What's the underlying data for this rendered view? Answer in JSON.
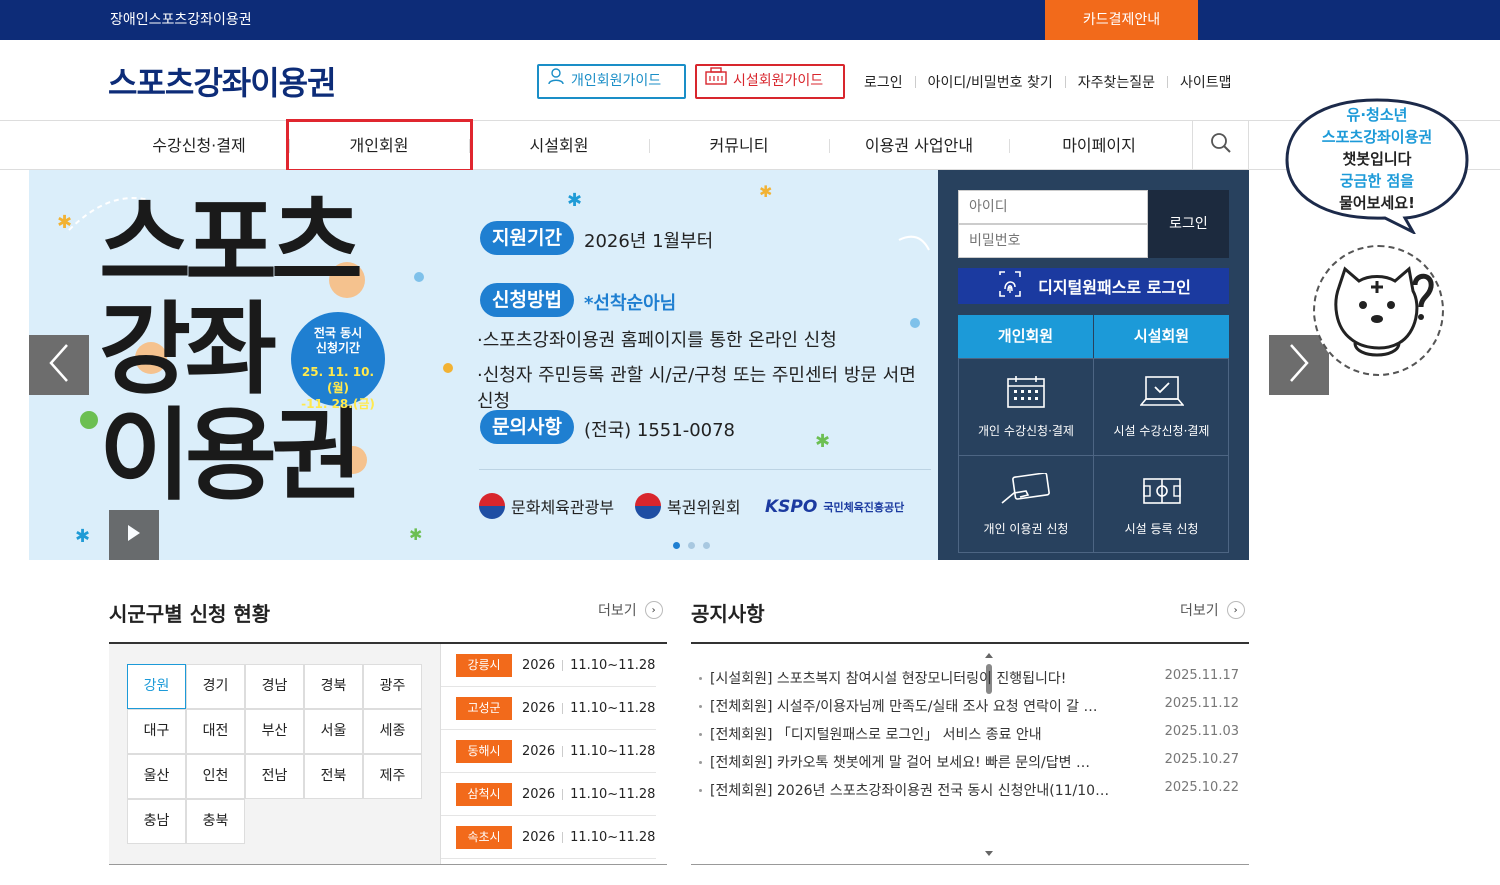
{
  "topbar": {
    "site_name": "장애인스포츠강좌이용권",
    "card_payment": "카드결제안내"
  },
  "header": {
    "logo": "스포츠강좌이용권",
    "guide_personal": "개인회원가이드",
    "guide_facility": "시설회원가이드",
    "util": [
      "로그인",
      "아이디/비밀번호 찾기",
      "자주찾는질문",
      "사이트맵"
    ]
  },
  "gnb": [
    "수강신청·결제",
    "개인회원",
    "시설회원",
    "커뮤니티",
    "이용권 사업안내",
    "마이페이지"
  ],
  "banner": {
    "title_lines": [
      "스포츠",
      "강좌",
      "이용권"
    ],
    "badge_line1": "전국 동시",
    "badge_line2": "신청기간",
    "badge_date1": "25. 11. 10.(월)",
    "badge_date2": "-11. 28.(금)",
    "period_label": "지원기간",
    "period_value": "2026년 1월부터",
    "method_label": "신청방법",
    "method_note": "*선착순아님",
    "method_line1": "·스포츠강좌이용권 홈페이지를 통한 온라인 신청",
    "method_line2": "·신청자 주민등록 관할 시/군/구청 또는 주민센터 방문 서면 신청",
    "contact_label": "문의사항",
    "contact_value": "(전국) 1551-0078",
    "orgs": [
      "문화체육관광부",
      "복권위원회"
    ],
    "kspo_logo": "KSPO",
    "kspo_name": "국민체육진흥공단"
  },
  "login": {
    "id_placeholder": "아이디",
    "pw_placeholder": "비밀번호",
    "login_button": "로그인",
    "digital_login": "디지털원패스로 로그인",
    "tab_personal": "개인회원",
    "tab_facility": "시설회원",
    "cells": [
      "개인 수강신청·결제",
      "시설 수강신청·결제",
      "개인 이용권 신청",
      "시설 등록 신청"
    ]
  },
  "chatbot": {
    "line1": "유·청소년",
    "line2": "스포츠강좌이용권",
    "line3": "챗봇입니다",
    "line4": "궁금한 점을",
    "line5": "물어보세요!"
  },
  "region_status": {
    "title": "시군구별 신청 현황",
    "more": "더보기",
    "regions": [
      "강원",
      "경기",
      "경남",
      "경북",
      "광주",
      "대구",
      "대전",
      "부산",
      "서울",
      "세종",
      "울산",
      "인천",
      "전남",
      "전북",
      "제주",
      "충남",
      "충북"
    ],
    "selected": "강원",
    "items": [
      {
        "city": "강릉시",
        "year": "2026",
        "period": "11.10~11.28"
      },
      {
        "city": "고성군",
        "year": "2026",
        "period": "11.10~11.28"
      },
      {
        "city": "동해시",
        "year": "2026",
        "period": "11.10~11.28"
      },
      {
        "city": "삼척시",
        "year": "2026",
        "period": "11.10~11.28"
      },
      {
        "city": "속초시",
        "year": "2026",
        "period": "11.10~11.28"
      }
    ]
  },
  "notices": {
    "title": "공지사항",
    "more": "더보기",
    "items": [
      {
        "title": "[시설회원] 스포츠복지 참여시설 현장모니터링이 진행됩니다!",
        "date": "2025.11.17"
      },
      {
        "title": "[전체회원] 시설주/이용자님께 만족도/실태 조사 요청 연락이 갈 …",
        "date": "2025.11.12"
      },
      {
        "title": "[전체회원] 「디지털원패스로 로그인」 서비스 종료 안내",
        "date": "2025.11.03"
      },
      {
        "title": "[전체회원] 카카오톡 챗봇에게 말 걸어 보세요! 빠른 문의/답변 …",
        "date": "2025.10.27"
      },
      {
        "title": "[전체회원] 2026년 스포츠강좌이용권 전국 동시 신청안내(11/10…",
        "date": "2025.10.22"
      }
    ]
  },
  "colors": {
    "navy": "#0d2c78",
    "orange": "#f26a1b",
    "blue": "#1c9ad8",
    "red": "#d8262d"
  }
}
